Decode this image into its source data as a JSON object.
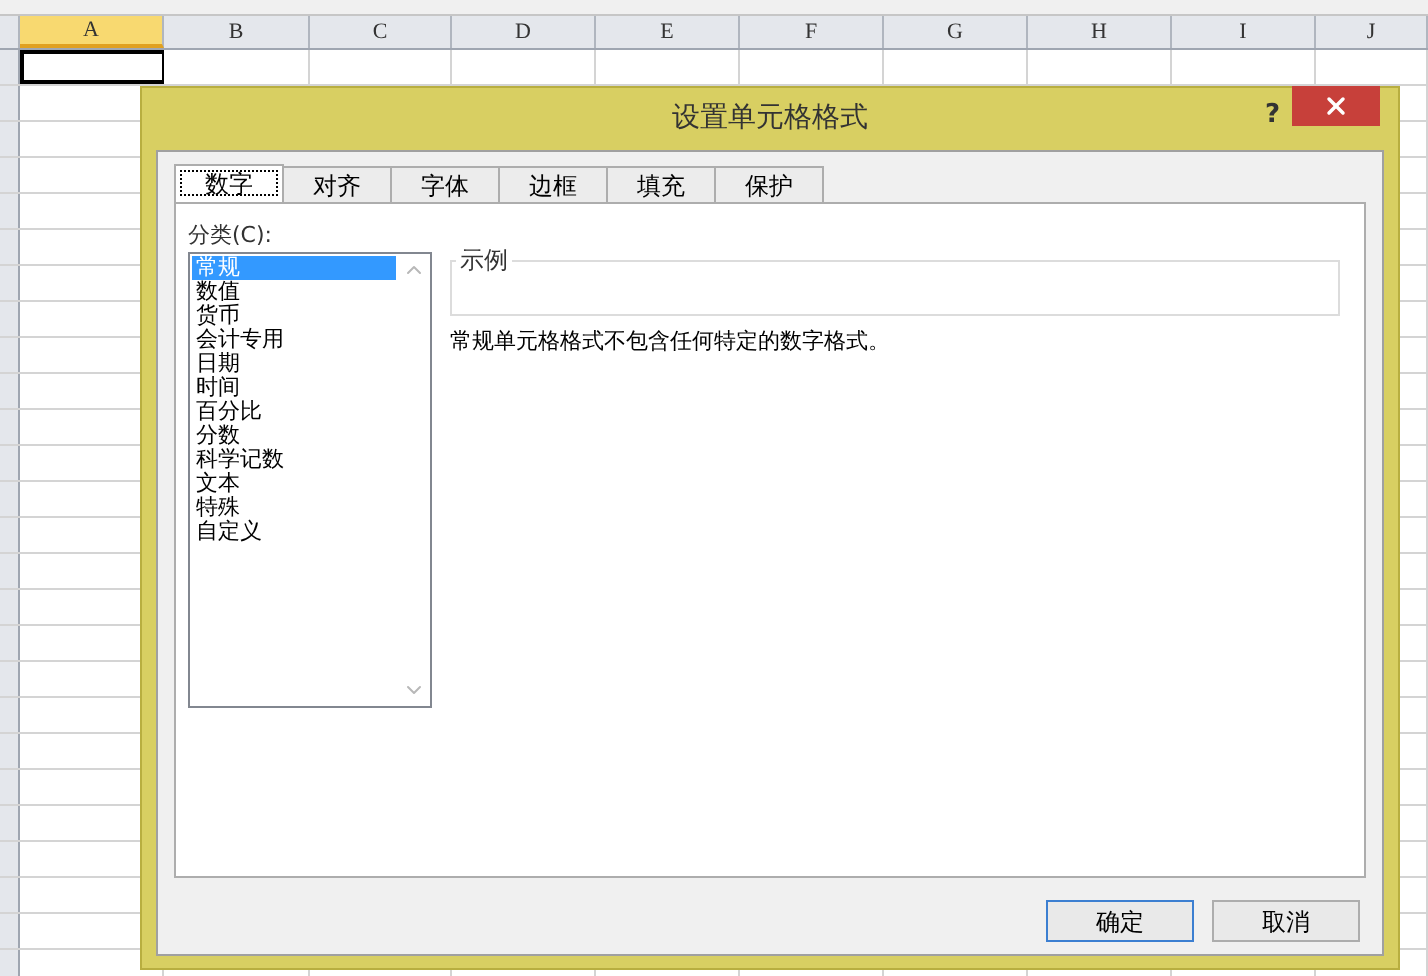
{
  "sheet": {
    "columns": [
      {
        "label": "A",
        "selected": true
      },
      {
        "label": "B",
        "selected": false
      },
      {
        "label": "C",
        "selected": false
      },
      {
        "label": "D",
        "selected": false
      },
      {
        "label": "E",
        "selected": false
      },
      {
        "label": "F",
        "selected": false
      },
      {
        "label": "G",
        "selected": false
      },
      {
        "label": "H",
        "selected": false
      },
      {
        "label": "I",
        "selected": false
      },
      {
        "label": "J",
        "selected": false
      }
    ]
  },
  "dialog": {
    "title": "设置单元格格式",
    "help": "?",
    "tabs": [
      {
        "label": "数字",
        "selected": true
      },
      {
        "label": "对齐",
        "selected": false
      },
      {
        "label": "字体",
        "selected": false
      },
      {
        "label": "边框",
        "selected": false
      },
      {
        "label": "填充",
        "selected": false
      },
      {
        "label": "保护",
        "selected": false
      }
    ],
    "category_label": "分类(C):",
    "categories": [
      {
        "label": "常规",
        "selected": true
      },
      {
        "label": "数值",
        "selected": false
      },
      {
        "label": "货币",
        "selected": false
      },
      {
        "label": "会计专用",
        "selected": false
      },
      {
        "label": "日期",
        "selected": false
      },
      {
        "label": "时间",
        "selected": false
      },
      {
        "label": "百分比",
        "selected": false
      },
      {
        "label": "分数",
        "selected": false
      },
      {
        "label": "科学记数",
        "selected": false
      },
      {
        "label": "文本",
        "selected": false
      },
      {
        "label": "特殊",
        "selected": false
      },
      {
        "label": "自定义",
        "selected": false
      }
    ],
    "sample_label": "示例",
    "description": "常规单元格格式不包含任何特定的数字格式。",
    "buttons": [
      {
        "label": "确定",
        "selected": true
      },
      {
        "label": "取消",
        "selected": false
      }
    ]
  }
}
